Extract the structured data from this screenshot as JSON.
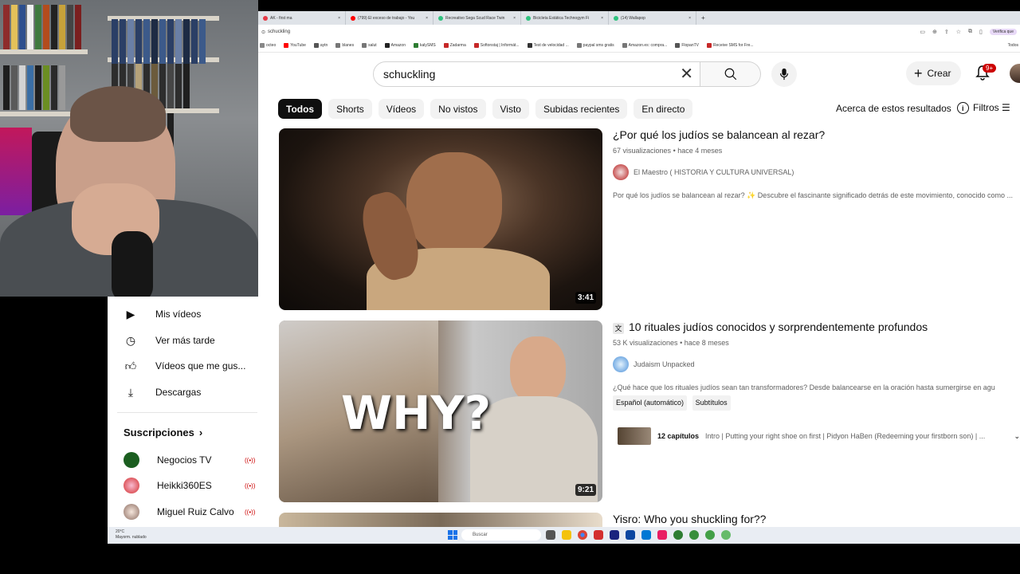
{
  "browser": {
    "tabs": [
      {
        "label": "AK - first ma",
        "color": "#e63946"
      },
      {
        "label": "(799) El exceso de trabajo - You",
        "color": "#ff0000"
      },
      {
        "label": "Recreativo Sega Scud Race Twin",
        "color": "#2ec27e"
      },
      {
        "label": "Bicicleta Estática Technogym Fi",
        "color": "#2ec27e"
      },
      {
        "label": "(14) Wallapop",
        "color": "#2ec27e"
      }
    ],
    "new_tab_icon": "+",
    "url": "schuckling",
    "profile_label": "Verifica que",
    "bookmarks": [
      {
        "label": "octeo",
        "color": "#888888"
      },
      {
        "label": "YouTube",
        "color": "#ff0000"
      },
      {
        "label": "aytn",
        "color": "#555555"
      },
      {
        "label": "blanes",
        "color": "#777777"
      },
      {
        "label": "salut",
        "color": "#777777"
      },
      {
        "label": "Amazon",
        "color": "#222222"
      },
      {
        "label": "kalySMS",
        "color": "#2e7d32"
      },
      {
        "label": "Zadarma",
        "color": "#c62828"
      },
      {
        "label": "Softonstaj | Informát...",
        "color": "#c62828"
      },
      {
        "label": "Test de velocidad ...",
        "color": "#333333"
      },
      {
        "label": "paypal sms gratis",
        "color": "#777777"
      },
      {
        "label": "Amazon.es: compra...",
        "color": "#777777"
      },
      {
        "label": "FlopanTV",
        "color": "#555555"
      },
      {
        "label": "Receive SMS for Fre...",
        "color": "#c62828"
      }
    ],
    "all_bookmarks": "Todos"
  },
  "masthead": {
    "search_value": "schuckling",
    "create_label": "Crear",
    "notifications_badge": "9+"
  },
  "chips": [
    "Todos",
    "Shorts",
    "Vídeos",
    "No vistos",
    "Visto",
    "Subidas recientes",
    "En directo"
  ],
  "about_results": "Acerca de estos resultados",
  "filters": "Filtros",
  "sidebar": {
    "items": [
      {
        "label": "Mis vídeos",
        "icon": "play-square-icon"
      },
      {
        "label": "Ver más tarde",
        "icon": "clock-icon"
      },
      {
        "label": "Vídeos que me gus...",
        "icon": "thumbs-up-icon"
      },
      {
        "label": "Descargas",
        "icon": "download-icon"
      }
    ],
    "subscriptions_heading": "Suscripciones",
    "subscriptions": [
      {
        "label": "Negocios TV",
        "color": "#1b5e20"
      },
      {
        "label": "Heikki360ES",
        "color": "#d32f2f"
      },
      {
        "label": "Miguel Ruiz Calvo",
        "color": "#8d6e63"
      }
    ]
  },
  "results": [
    {
      "title": "¿Por qué los judíos se balancean al rezar?",
      "views": "67 visualizaciones",
      "age": "hace 4 meses",
      "channel": "El Maestro ( HISTORIA Y CULTURA UNIVERSAL)",
      "channel_color": "#b71c1c",
      "description": "Por qué los judíos se balancean al rezar? ✨ Descubre el fascinante significado detrás de este movimiento, conocido como ...",
      "duration": "3:41"
    },
    {
      "title": "10 rituales judíos conocidos y sorprendentemente profundos",
      "views": "53 K visualizaciones",
      "age": "hace 8 meses",
      "channel": "Judaism Unpacked",
      "channel_color": "#4a90d9",
      "description": "¿Qué hace que los rituales judíos sean tan transformadores? Desde balancearse en la oración hasta sumergirse en agu",
      "badges": [
        "Español (automático)",
        "Subtítulos"
      ],
      "chapters_count": "12 capítulos",
      "chapters_text": "Intro | Putting your right shoe on first | Pidyon HaBen (Redeeming your firstborn son) | ...",
      "thumbnail_text": "WHY?",
      "duration": "9:21"
    },
    {
      "title": "Yisro: Who you shuckling for??"
    }
  ],
  "taskbar": {
    "weather_temp": "20°C",
    "weather_desc": "Mayorm. nublado",
    "search_label": "Buscar"
  }
}
